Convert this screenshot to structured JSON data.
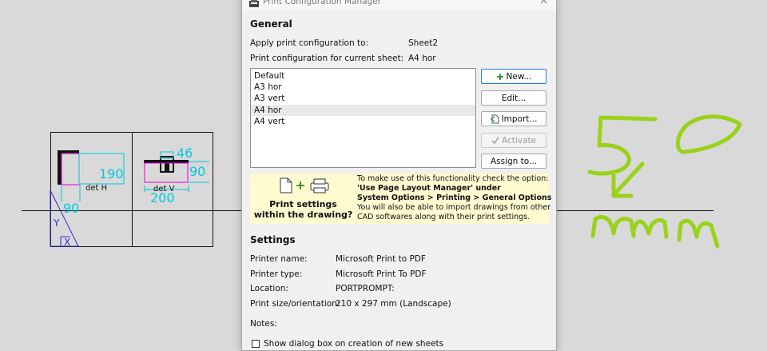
{
  "background": {
    "color": "#d9d9d9",
    "drawing_color": "#111111",
    "dim_color": "#00c8e0",
    "highlight_color": "#e800e0",
    "handwriting_color": "#9ad21a",
    "labels": {
      "det_h": "det H",
      "det_v": "det V",
      "dim_190": "190",
      "dim_90_left": "90",
      "dim_46": "46",
      "dim_90_right": "90",
      "dim_200": "200"
    },
    "annotation": "5 mm"
  },
  "dialog": {
    "title": "Print Configuration Manager",
    "general": {
      "heading": "General",
      "apply_label": "Apply print configuration to:",
      "apply_value": "Sheet2",
      "current_label": "Print configuration for current sheet:",
      "current_value": "A4 hor"
    },
    "configs": [
      "Default",
      "A3 hor",
      "A3 vert",
      "A4 hor",
      "A4 vert"
    ],
    "selected_config": "A4 hor",
    "buttons": {
      "new": "New...",
      "edit": "Edit...",
      "import": "Import...",
      "activate": "Activate",
      "assign": "Assign to..."
    },
    "info": {
      "caption_line1": "Print settings",
      "caption_line2": "within the drawing?",
      "line1": "To make use of this functionality check the option:",
      "line2": "'Use Page Layout Manager' under",
      "line3": "System Options > Printing > General Options",
      "line4": "You will also be able to import drawings from other",
      "line5": "CAD softwares along with their print settings."
    },
    "settings": {
      "heading": "Settings",
      "printer_name_label": "Printer name:",
      "printer_name_value": "Microsoft Print to PDF",
      "printer_type_label": "Printer type:",
      "printer_type_value": "Microsoft Print To PDF",
      "location_label": "Location:",
      "location_value": "PORTPROMPT:",
      "size_label": "Print size/orientation:",
      "size_value": "210 x 297 mm (Landscape)",
      "notes_label": "Notes:",
      "checkbox_label": "Show dialog box on creation of new sheets"
    }
  }
}
